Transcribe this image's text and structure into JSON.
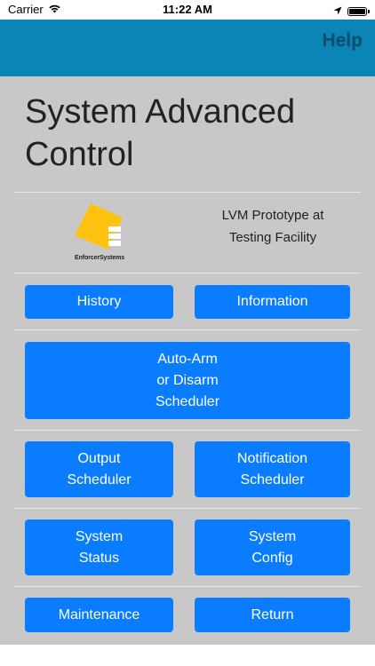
{
  "status_bar": {
    "carrier": "Carrier",
    "time": "11:22 AM",
    "icons": [
      "wifi-icon",
      "location-arrow-icon",
      "battery-icon"
    ]
  },
  "nav": {
    "help_label": "Help"
  },
  "page": {
    "title": "System Advanced Control",
    "logo_text": "EnforcerSystems",
    "facility": "LVM Prototype at\nTesting Facility"
  },
  "buttons": {
    "history": "History",
    "information": "Information",
    "auto_arm": "Auto-Arm\nor Disarm\nScheduler",
    "output_scheduler": "Output\nScheduler",
    "notification_scheduler": "Notification\nScheduler",
    "system_status": "System\nStatus",
    "system_config": "System\nConfig",
    "maintenance": "Maintenance",
    "return": "Return"
  },
  "colors": {
    "navbar": "#0a85b6",
    "button": "#0a7cff",
    "content_bg": "#c8c8c8",
    "logo_yellow": "#ffc20e"
  }
}
